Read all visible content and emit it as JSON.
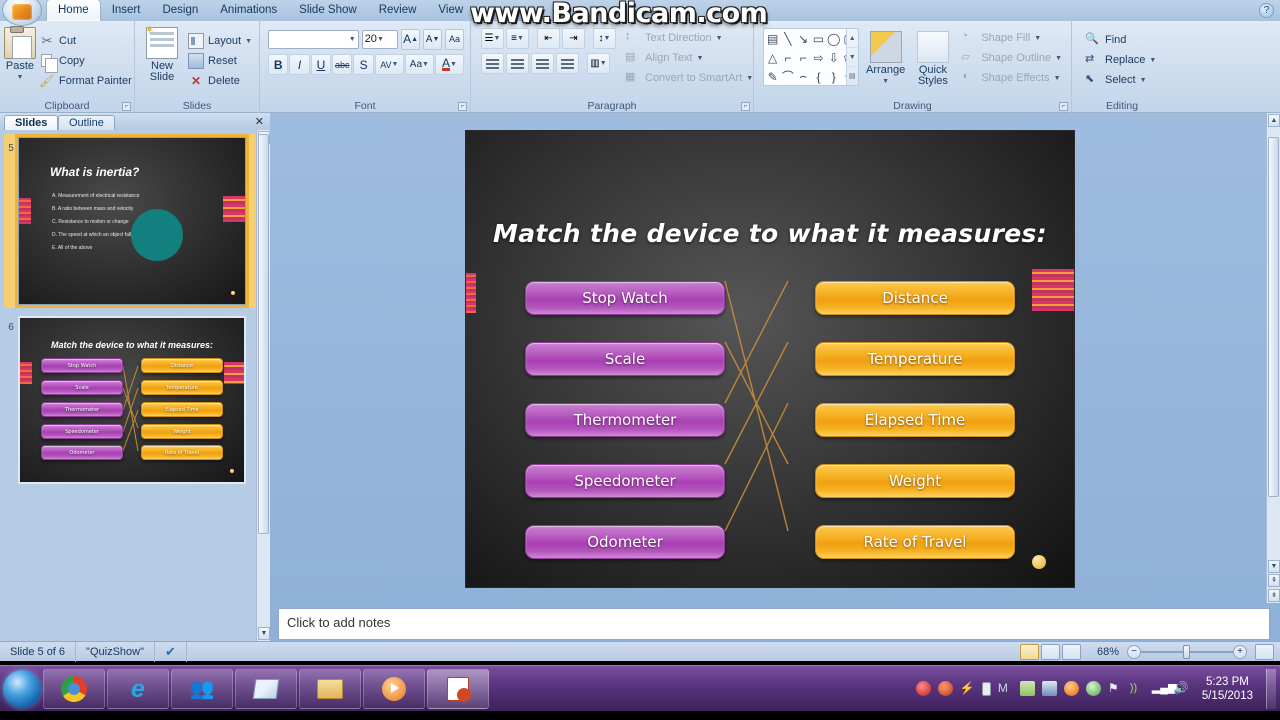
{
  "window": {
    "app": "Microsoft PowerPoint",
    "watermark": "www.Bandicam.com",
    "help_icon": "?"
  },
  "ribbon": {
    "tabs": [
      {
        "label": "Home",
        "active": true
      },
      {
        "label": "Insert",
        "active": false
      },
      {
        "label": "Design",
        "active": false
      },
      {
        "label": "Animations",
        "active": false
      },
      {
        "label": "Slide Show",
        "active": false
      },
      {
        "label": "Review",
        "active": false
      },
      {
        "label": "View",
        "active": false
      }
    ],
    "groups": {
      "clipboard": {
        "title": "Clipboard",
        "paste": "Paste",
        "cut": "Cut",
        "copy": "Copy",
        "format_painter": "Format Painter"
      },
      "slides": {
        "title": "Slides",
        "new_slide_line1": "New",
        "new_slide_line2": "Slide",
        "layout": "Layout",
        "reset": "Reset",
        "delete": "Delete"
      },
      "font": {
        "title": "Font",
        "font_name_value": "",
        "font_name_placeholder": "",
        "font_size_value": "20",
        "grow_font": "A",
        "shrink_font": "A",
        "clear_formatting": "Aa",
        "bold": "B",
        "italic": "I",
        "underline": "U",
        "strikethrough": "abc",
        "shadow": "S",
        "character_spacing": "AV",
        "change_case": "Aa",
        "font_color": "A"
      },
      "paragraph": {
        "title": "Paragraph",
        "text_direction": "Text Direction",
        "align_text": "Align Text",
        "convert_to_smartart": "Convert to SmartArt"
      },
      "drawing": {
        "title": "Drawing",
        "arrange": "Arrange",
        "quick_styles_line1": "Quick",
        "quick_styles_line2": "Styles",
        "shape_fill": "Shape Fill",
        "shape_outline": "Shape Outline",
        "shape_effects": "Shape Effects"
      },
      "editing": {
        "title": "Editing",
        "find": "Find",
        "replace": "Replace",
        "select": "Select"
      }
    }
  },
  "slides_panel": {
    "tab_slides": "Slides",
    "tab_outline": "Outline",
    "close": "✕",
    "thumbnails": [
      {
        "number": "5",
        "active": true,
        "title": "What is inertia?",
        "options": [
          "A.  Measurement of electrical resistance",
          "B.  A ratio between mass and velocity",
          "C.  Resistance to motion or change",
          "D.  The speed at which an object falls",
          "E.  All of the above"
        ]
      },
      {
        "number": "6",
        "active": false,
        "title": "Match the device to what it measures:",
        "left_items": [
          "Stop Watch",
          "Scale",
          "Thermometer",
          "Speedometer",
          "Odometer"
        ],
        "right_items": [
          "Distance",
          "Temperature",
          "Elapsed Time",
          "Weight",
          "Rate of Travel"
        ]
      }
    ]
  },
  "slide": {
    "title": "Match the device to what it measures:",
    "left_items": [
      "Stop Watch",
      "Scale",
      "Thermometer",
      "Speedometer",
      "Odometer"
    ],
    "right_items": [
      "Distance",
      "Temperature",
      "Elapsed Time",
      "Weight",
      "Rate of Travel"
    ],
    "colors": {
      "left_pill": "#b04fbb",
      "right_pill": "#f5b01d",
      "connector": "#c28a3a",
      "background": "#3b3b3b",
      "title_text": "#ffffff"
    }
  },
  "notes": {
    "placeholder": "Click to add notes"
  },
  "statusbar": {
    "slide_counter": "Slide 5 of 6",
    "theme_name": "\"QuizShow\"",
    "spellcheck_icon": "spellcheck-icon",
    "zoom_level": "68%",
    "zoom_out": "−",
    "zoom_in": "+",
    "views": [
      "normal-view",
      "slide-sorter-view",
      "slide-show-view"
    ]
  },
  "taskbar": {
    "start": "start-orb",
    "items": [
      "chrome-icon",
      "internet-explorer-icon",
      "messenger-icon",
      "paint-icon",
      "file-explorer-icon",
      "media-player-icon",
      "powerpoint-icon"
    ],
    "tray": [
      "record-icon",
      "bandicam-icon",
      "action-center-icon",
      "battery-icon",
      "mcafee-icon",
      "mail-icon",
      "display-icon",
      "firefox-icon",
      "safety-icon",
      "flag-icon",
      "antenna-icon",
      "network-icon",
      "volume-icon"
    ],
    "time": "5:23 PM",
    "date": "5/15/2013"
  }
}
